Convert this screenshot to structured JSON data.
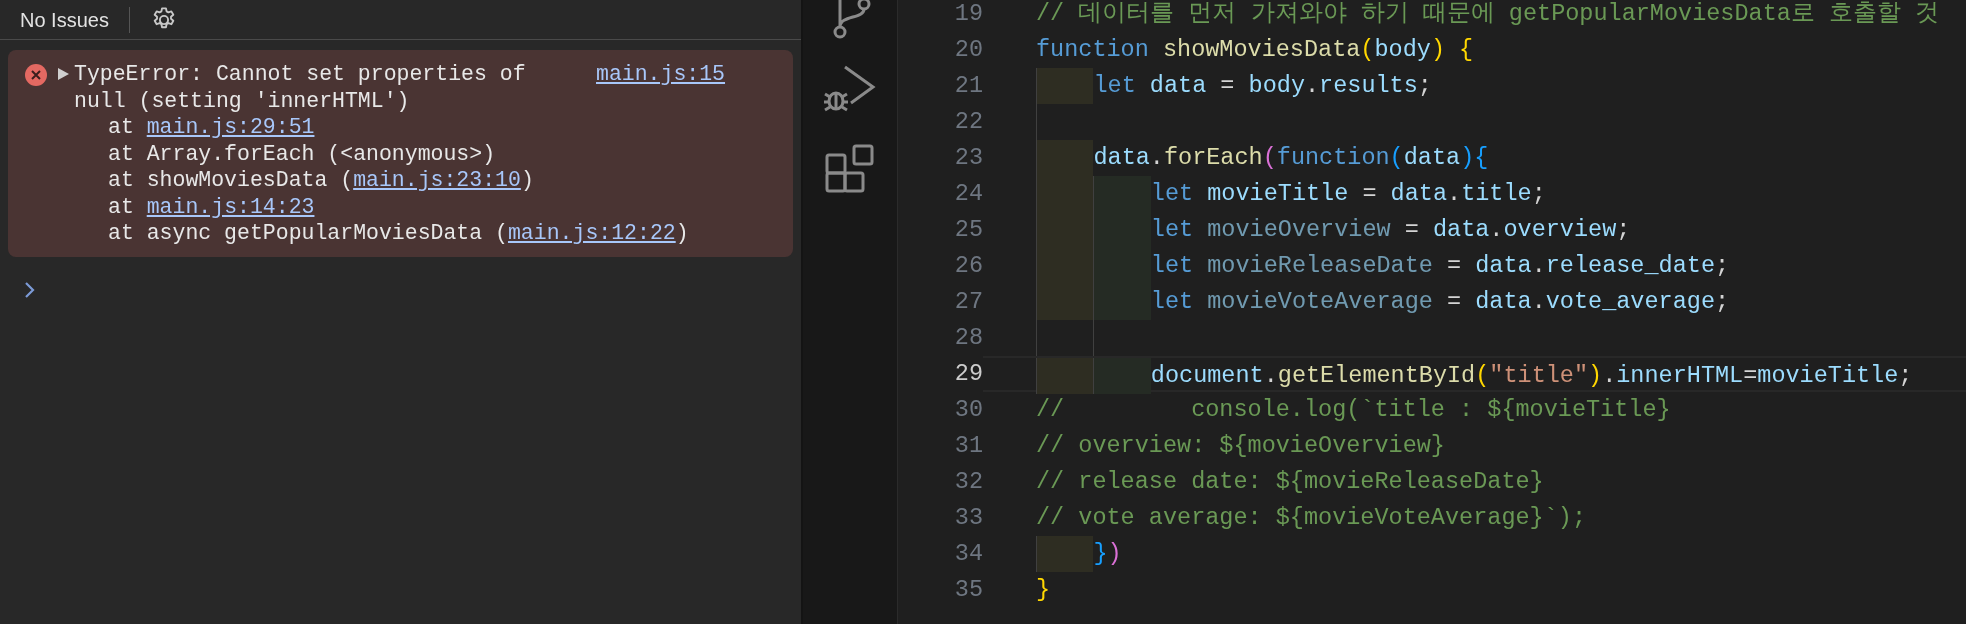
{
  "console": {
    "toolbar": {
      "issues": "No Issues"
    },
    "error": {
      "expanded": false,
      "message": "TypeError: Cannot set properties of null (setting 'innerHTML')",
      "source": "main.js:15",
      "stack": [
        {
          "before": "at ",
          "link": "main.js:29:51"
        },
        {
          "before": "at Array.forEach (<anonymous>)"
        },
        {
          "before": "at showMoviesData (",
          "link": "main.js:23:10",
          "after": ")"
        },
        {
          "before": "at ",
          "link": "main.js:14:23"
        },
        {
          "before": "at async getPopularMoviesData (",
          "link": "main.js:12:22",
          "after": ")"
        }
      ]
    }
  },
  "editor": {
    "lines": [
      {
        "number": "19",
        "active": false,
        "tokens": [
          {
            "kind": "comment",
            "text": "// 데이터를 먼저 가져와야 하기 때문에 getPopularMoviesData로 호출할 것"
          }
        ]
      },
      {
        "number": "20",
        "active": false,
        "tokens": [
          {
            "kind": "keyword",
            "text": "function "
          },
          {
            "kind": "function",
            "text": "showMoviesData"
          },
          {
            "kind": "bracket1",
            "text": "("
          },
          {
            "kind": "variable",
            "text": "body"
          },
          {
            "kind": "bracket1",
            "text": ")"
          },
          {
            "kind": "bracket1",
            "text": " {"
          }
        ]
      },
      {
        "number": "21",
        "active": false,
        "tokens": [
          {
            "kind": "indent"
          },
          {
            "kind": "keyword",
            "text": "let "
          },
          {
            "kind": "variable",
            "text": "data"
          },
          {
            "kind": "plain",
            "text": " = "
          },
          {
            "kind": "variable",
            "text": "body"
          },
          {
            "kind": "plain",
            "text": "."
          },
          {
            "kind": "variable",
            "text": "results"
          },
          {
            "kind": "plain",
            "text": ";"
          }
        ]
      },
      {
        "number": "22",
        "active": false,
        "tokens": [
          {
            "kind": "indent"
          }
        ]
      },
      {
        "number": "23",
        "active": false,
        "tokens": [
          {
            "kind": "indent"
          },
          {
            "kind": "variable",
            "text": "data"
          },
          {
            "kind": "plain",
            "text": "."
          },
          {
            "kind": "function",
            "text": "forEach"
          },
          {
            "kind": "bracket2",
            "text": "("
          },
          {
            "kind": "keyword",
            "text": "function"
          },
          {
            "kind": "bracket3",
            "text": "("
          },
          {
            "kind": "variable",
            "text": "data"
          },
          {
            "kind": "bracket3",
            "text": ")"
          },
          {
            "kind": "bracket3",
            "text": "{"
          }
        ]
      },
      {
        "number": "24",
        "active": false,
        "tokens": [
          {
            "kind": "indent"
          },
          {
            "kind": "indent"
          },
          {
            "kind": "keyword",
            "text": "let "
          },
          {
            "kind": "variable",
            "text": "movieTitle"
          },
          {
            "kind": "plain",
            "text": " = "
          },
          {
            "kind": "variable",
            "text": "data"
          },
          {
            "kind": "plain",
            "text": "."
          },
          {
            "kind": "variable",
            "text": "title"
          },
          {
            "kind": "plain",
            "text": ";"
          }
        ]
      },
      {
        "number": "25",
        "active": false,
        "tokens": [
          {
            "kind": "indent"
          },
          {
            "kind": "indent"
          },
          {
            "kind": "keyword",
            "text": "let "
          },
          {
            "kind": "unused",
            "text": "movieOverview"
          },
          {
            "kind": "plain",
            "text": " = "
          },
          {
            "kind": "variable",
            "text": "data"
          },
          {
            "kind": "plain",
            "text": "."
          },
          {
            "kind": "variable",
            "text": "overview"
          },
          {
            "kind": "plain",
            "text": ";"
          }
        ]
      },
      {
        "number": "26",
        "active": false,
        "tokens": [
          {
            "kind": "indent"
          },
          {
            "kind": "indent"
          },
          {
            "kind": "keyword",
            "text": "let "
          },
          {
            "kind": "unused",
            "text": "movieReleaseDate"
          },
          {
            "kind": "plain",
            "text": " = "
          },
          {
            "kind": "variable",
            "text": "data"
          },
          {
            "kind": "plain",
            "text": "."
          },
          {
            "kind": "variable",
            "text": "release_date"
          },
          {
            "kind": "plain",
            "text": ";"
          }
        ]
      },
      {
        "number": "27",
        "active": false,
        "tokens": [
          {
            "kind": "indent"
          },
          {
            "kind": "indent"
          },
          {
            "kind": "keyword",
            "text": "let "
          },
          {
            "kind": "unused",
            "text": "movieVoteAverage"
          },
          {
            "kind": "plain",
            "text": " = "
          },
          {
            "kind": "variable",
            "text": "data"
          },
          {
            "kind": "plain",
            "text": "."
          },
          {
            "kind": "variable",
            "text": "vote_average"
          },
          {
            "kind": "plain",
            "text": ";"
          }
        ]
      },
      {
        "number": "28",
        "active": false,
        "tokens": [
          {
            "kind": "indent"
          },
          {
            "kind": "indent"
          }
        ]
      },
      {
        "number": "29",
        "active": true,
        "tokens": [
          {
            "kind": "indent"
          },
          {
            "kind": "indent"
          },
          {
            "kind": "variable",
            "text": "document"
          },
          {
            "kind": "plain",
            "text": "."
          },
          {
            "kind": "function",
            "text": "getElementById"
          },
          {
            "kind": "bracket1",
            "text": "("
          },
          {
            "kind": "string",
            "text": "\"title\""
          },
          {
            "kind": "bracket1",
            "text": ")"
          },
          {
            "kind": "plain",
            "text": "."
          },
          {
            "kind": "variable",
            "text": "innerHTML"
          },
          {
            "kind": "plain",
            "text": "="
          },
          {
            "kind": "variable",
            "text": "movieTitle"
          },
          {
            "kind": "plain",
            "text": ";"
          }
        ]
      },
      {
        "number": "30",
        "active": false,
        "tokens": [
          {
            "kind": "comment",
            "text": "//         console.log(`title : ${movieTitle}"
          }
        ]
      },
      {
        "number": "31",
        "active": false,
        "tokens": [
          {
            "kind": "comment",
            "text": "// overview: ${movieOverview}"
          }
        ]
      },
      {
        "number": "32",
        "active": false,
        "tokens": [
          {
            "kind": "comment",
            "text": "// release date: ${movieReleaseDate}"
          }
        ]
      },
      {
        "number": "33",
        "active": false,
        "tokens": [
          {
            "kind": "comment",
            "text": "// vote average: ${movieVoteAverage}`);"
          }
        ]
      },
      {
        "number": "34",
        "active": false,
        "tokens": [
          {
            "kind": "indent"
          },
          {
            "kind": "bracket3",
            "text": "}"
          },
          {
            "kind": "bracket2",
            "text": ")"
          }
        ]
      },
      {
        "number": "35",
        "active": false,
        "tokens": [
          {
            "kind": "bracket1",
            "text": "}"
          }
        ]
      }
    ]
  }
}
